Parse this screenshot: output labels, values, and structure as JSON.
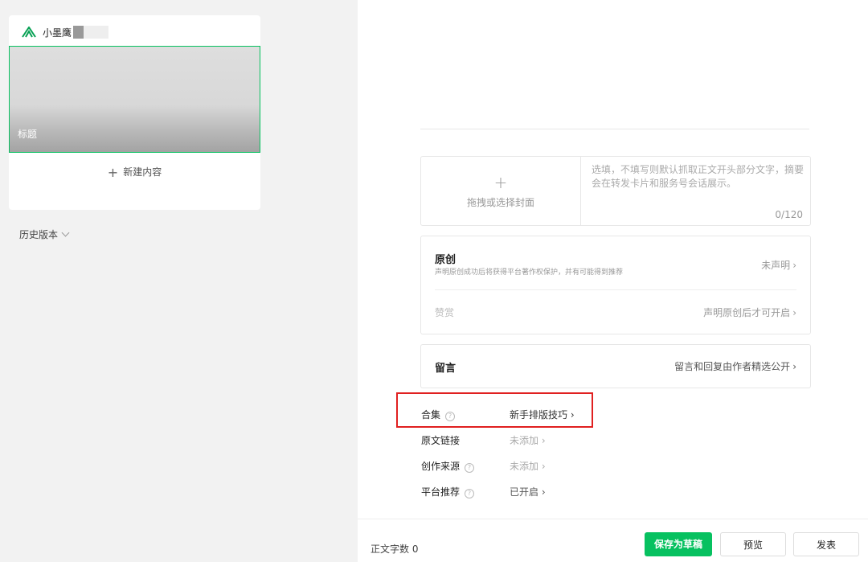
{
  "account": {
    "name": "小墨鹰"
  },
  "article": {
    "cover_title": "标题"
  },
  "actions": {
    "new_content": "新建内容",
    "history": "历史版本"
  },
  "cover_box": {
    "pick_label": "拖拽或选择封面",
    "summary_placeholder": "选填，不填写则默认抓取正文开头部分文字，摘要会在转发卡片和服务号会话展示。",
    "counter": "0/120"
  },
  "original": {
    "title": "原创",
    "subtitle": "声明原创成功后将获得平台著作权保护，并有可能得到推荐",
    "value": "未声明"
  },
  "reward": {
    "title": "赞赏",
    "value": "声明原创后才可开启"
  },
  "comments": {
    "title": "留言",
    "value": "留言和回复由作者精选公开"
  },
  "options": [
    {
      "label": "合集",
      "value": "新手排版技巧",
      "help": true
    },
    {
      "label": "原文链接",
      "value": "未添加",
      "help": false
    },
    {
      "label": "创作来源",
      "value": "未添加",
      "help": true
    },
    {
      "label": "平台推荐",
      "value": "已开启",
      "help": true
    }
  ],
  "footer": {
    "word_count_label": "正文字数",
    "word_count": "0",
    "save_draft": "保存为草稿",
    "preview": "预览",
    "publish": "发表"
  },
  "colors": {
    "accent": "#07c160",
    "highlight_border": "#e02020"
  }
}
